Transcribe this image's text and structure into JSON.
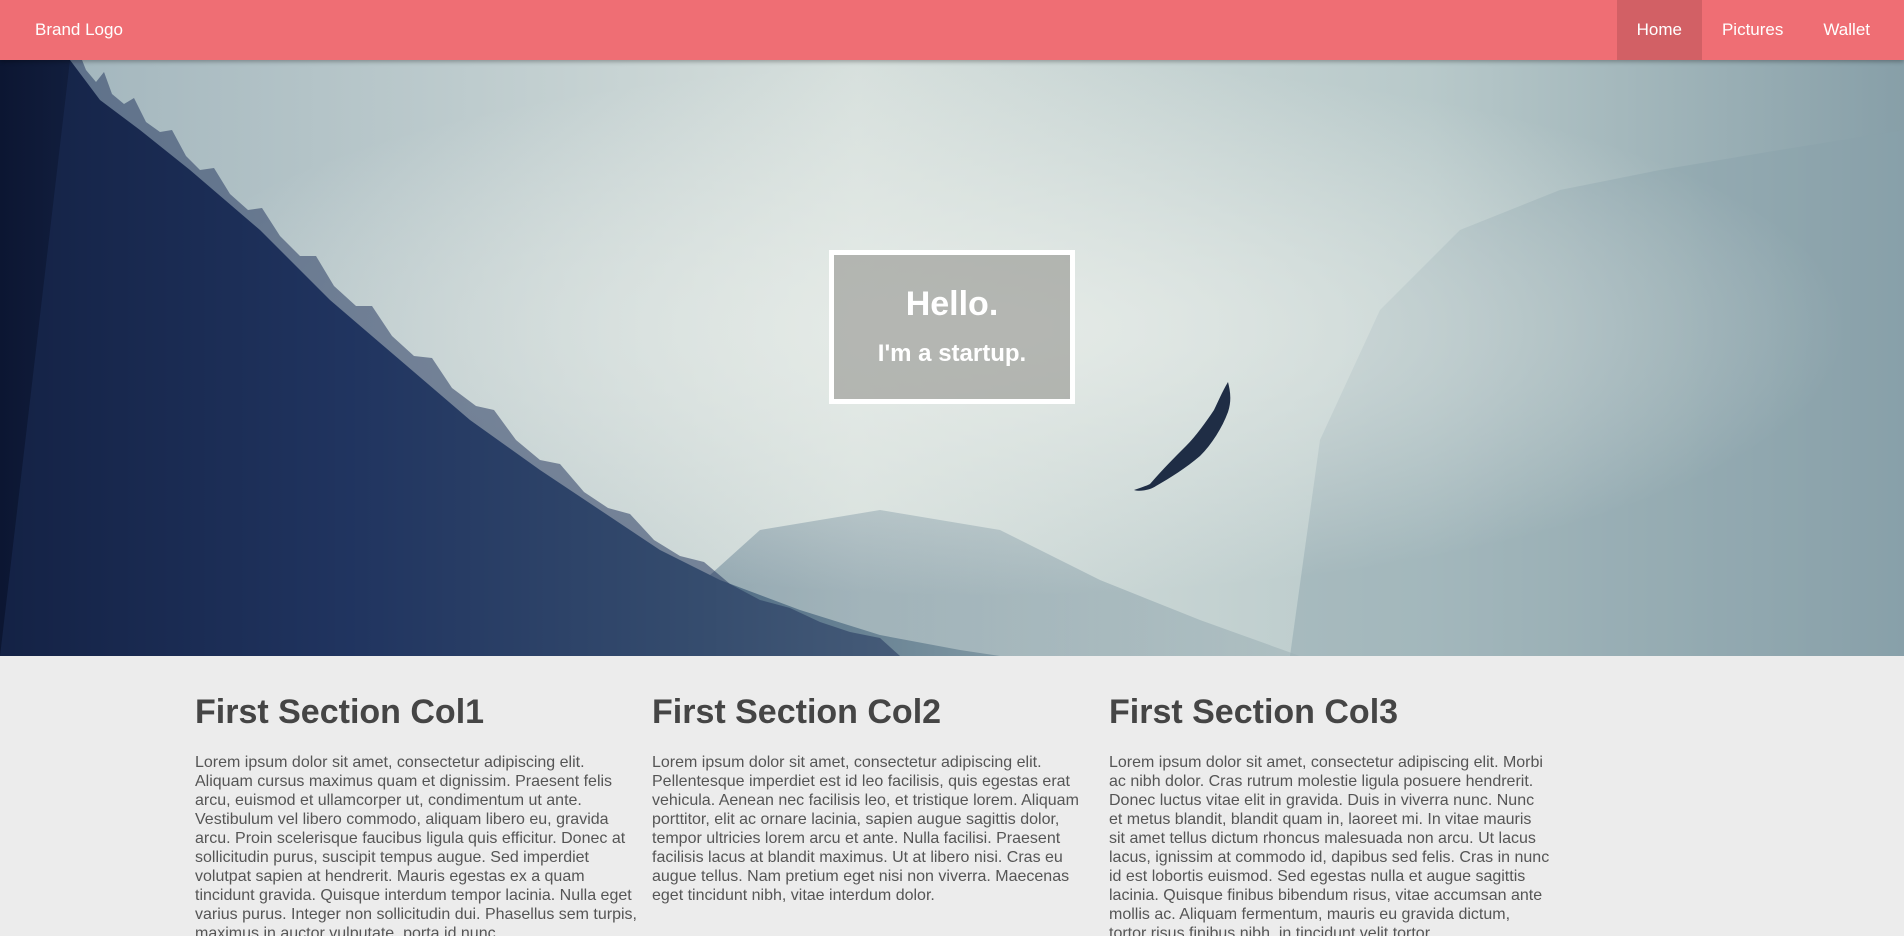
{
  "navbar": {
    "brand": "Brand Logo",
    "links": [
      {
        "label": "Home",
        "active": true
      },
      {
        "label": "Pictures",
        "active": false
      },
      {
        "label": "Wallet",
        "active": false
      }
    ],
    "color": "#ef6e74"
  },
  "hero": {
    "title": "Hello.",
    "subtitle": "I'm a startup."
  },
  "section": {
    "columns": [
      {
        "heading": "First Section Col1",
        "text": "Lorem ipsum dolor sit amet, consectetur adipiscing elit. Aliquam cursus maximus quam et dignissim. Praesent felis arcu, euismod et ullamcorper ut, condimentum ut ante. Vestibulum vel libero commodo, aliquam libero eu, gravida arcu. Proin scelerisque faucibus ligula quis efficitur. Donec at sollicitudin purus, suscipit tempus augue. Sed imperdiet volutpat sapien at hendrerit. Mauris egestas ex a quam tincidunt gravida. Quisque interdum tempor lacinia. Nulla eget varius purus. Integer non sollicitudin dui. Phasellus sem turpis, maximus in auctor vulputate, porta id nunc."
      },
      {
        "heading": "First Section Col2",
        "text": "Lorem ipsum dolor sit amet, consectetur adipiscing elit. Pellentesque imperdiet est id leo facilisis, quis egestas erat vehicula. Aenean nec facilisis leo, et tristique lorem. Aliquam porttitor, elit ac ornare lacinia, sapien augue sagittis dolor, tempor ultricies lorem arcu et ante. Nulla facilisi. Praesent facilisis lacus at blandit maximus. Ut at libero nisi. Cras eu augue tellus. Nam pretium eget nisi non viverra. Maecenas eget tincidunt nibh, vitae interdum dolor."
      },
      {
        "heading": "First Section Col3",
        "text": "Lorem ipsum dolor sit amet, consectetur adipiscing elit. Morbi ac nibh dolor. Cras rutrum molestie ligula posuere hendrerit. Donec luctus vitae elit in gravida. Duis in viverra nunc. Nunc et metus blandit, blandit quam in, laoreet mi. In vitae mauris sit amet tellus dictum rhoncus malesuada non arcu. Ut lacus lacus, ignissim at commodo id, dapibus sed felis. Cras in nunc id est lobortis euismod. Sed egestas nulla et augue sagittis lacinia. Quisque finibus bibendum risus, vitae accumsan ante mollis ac. Aliquam fermentum, mauris eu gravida dictum, tortor risus finibus nibh, in tincidunt velit tortor."
      }
    ]
  }
}
